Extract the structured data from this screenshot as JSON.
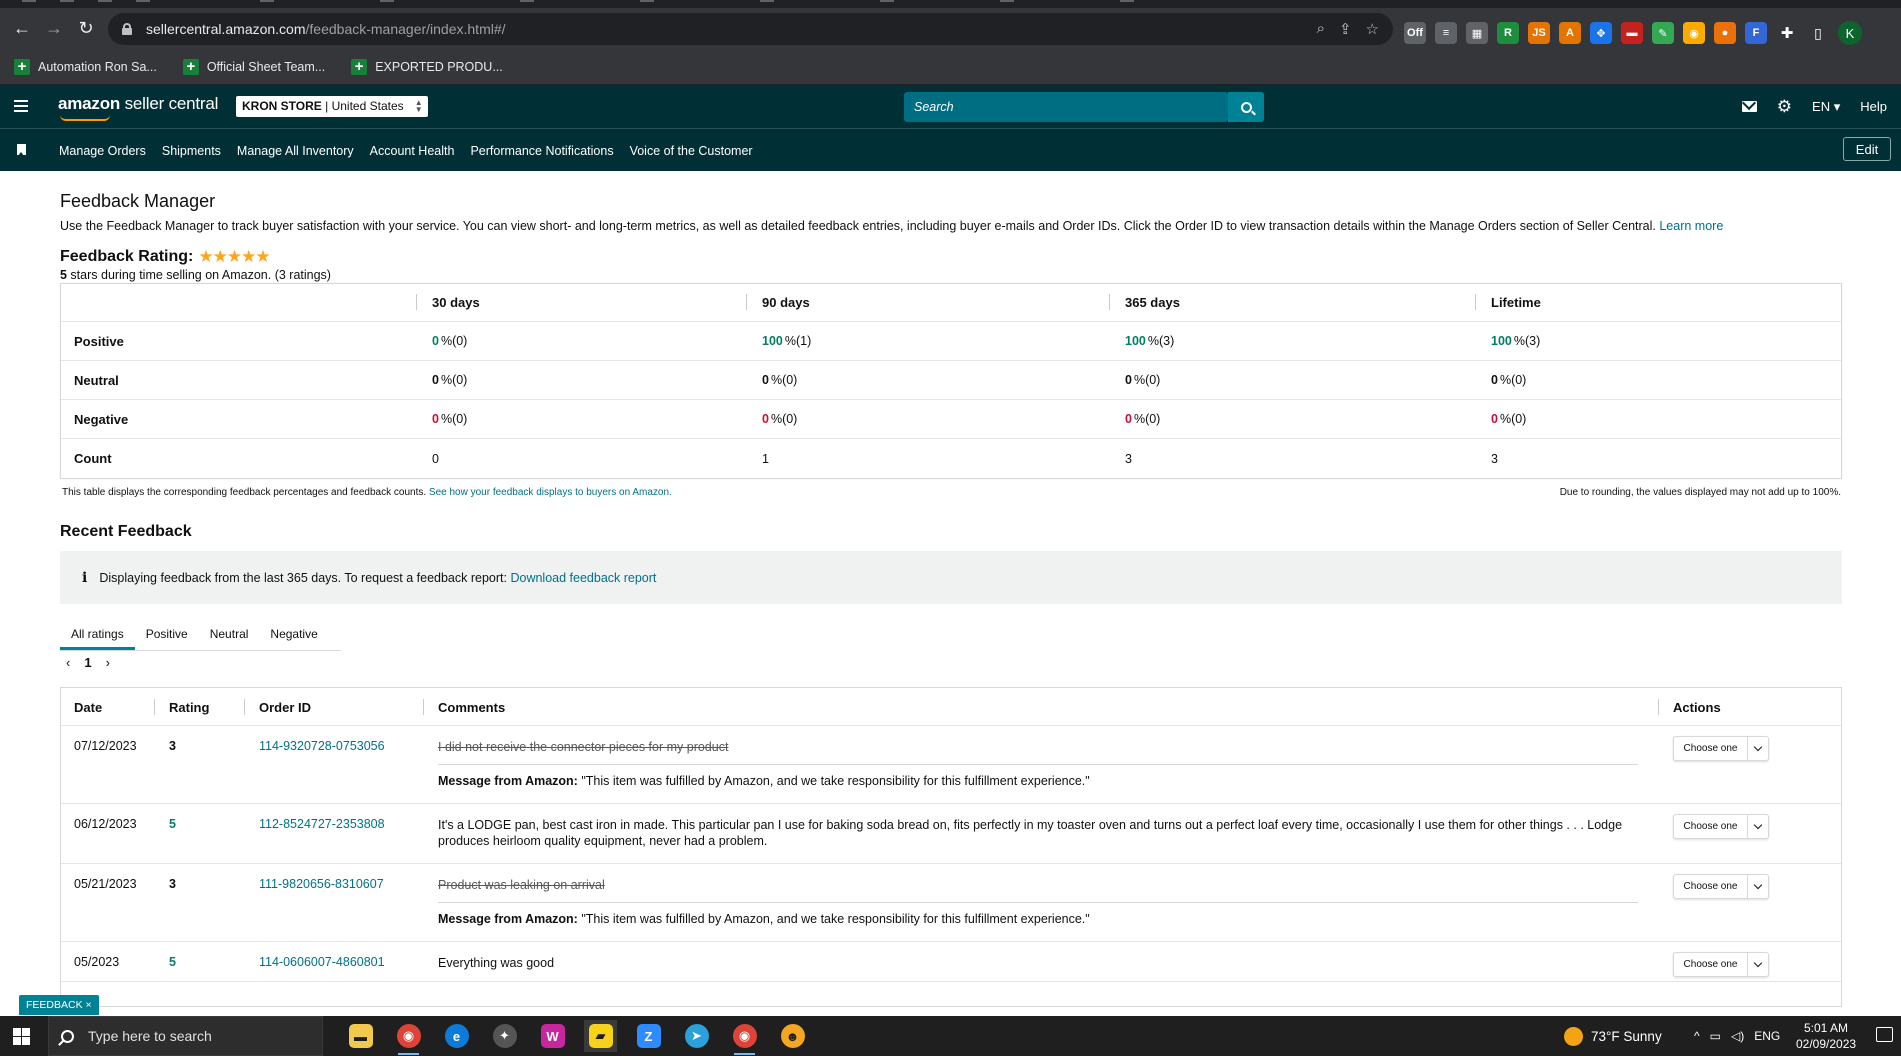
{
  "browser": {
    "url_host": "sellercentral.amazon.com",
    "url_path": "/feedback-manager/index.html#/",
    "bookmarks": [
      "Automation Ron Sa...",
      "Official Sheet Team...",
      "EXPORTED PRODU..."
    ],
    "profile_initial": "K",
    "extensions": [
      {
        "name": "off",
        "text": "Off",
        "color": "#5f6368"
      },
      {
        "name": "ext-a",
        "text": "≡",
        "color": "#5f6368"
      },
      {
        "name": "ext-b",
        "text": "▦",
        "color": "#5f6368"
      },
      {
        "name": "ext-r",
        "text": "R",
        "color": "#1e8e3e"
      },
      {
        "name": "ext-js",
        "text": "JS",
        "color": "#e37400"
      },
      {
        "name": "ext-az",
        "text": "A",
        "color": "#e37400"
      },
      {
        "name": "ext-move",
        "text": "✥",
        "color": "#1a73e8"
      },
      {
        "name": "ext-red",
        "text": "▬",
        "color": "#c5221f"
      },
      {
        "name": "ext-pen",
        "text": "✎",
        "color": "#34a853"
      },
      {
        "name": "ext-chrome",
        "text": "◉",
        "color": "#f9ab00"
      },
      {
        "name": "ext-o",
        "text": "●",
        "color": "#e8710a"
      },
      {
        "name": "ext-f",
        "text": "F",
        "color": "#3367d6"
      }
    ]
  },
  "header": {
    "logo_bold": "amazon",
    "logo_rest": " seller central",
    "store_name": "KRON STORE",
    "store_region": " | United States",
    "search_placeholder": "Search",
    "lang": "EN ▾",
    "help": "Help"
  },
  "nav": {
    "links": [
      "Manage Orders",
      "Shipments",
      "Manage All Inventory",
      "Account Health",
      "Performance Notifications",
      "Voice of the Customer"
    ],
    "edit": "Edit"
  },
  "page": {
    "title": "Feedback Manager",
    "description": "Use the Feedback Manager to track buyer satisfaction with your service. You can view short- and long-term metrics, as well as detailed feedback entries, including buyer e-mails and Order IDs. Click the Order ID to view transaction details within the Manage Orders section of Seller Central.",
    "learn_more": "Learn more",
    "rating_label": "Feedback Rating:",
    "stars": "★★★★★",
    "rating_summary_bold": "5",
    "rating_summary": " stars during time selling on Amazon. (3 ratings)"
  },
  "metrics": {
    "columns": [
      "30 days",
      "90 days",
      "365 days",
      "Lifetime"
    ],
    "rows": [
      {
        "label": "Positive",
        "kind": "positive",
        "values": [
          [
            "0",
            " %(0)"
          ],
          [
            "100",
            " %(1)"
          ],
          [
            "100",
            " %(3)"
          ],
          [
            "100",
            " %(3)"
          ]
        ]
      },
      {
        "label": "Neutral",
        "kind": "neutral",
        "values": [
          [
            "0",
            " %(0)"
          ],
          [
            "0",
            " %(0)"
          ],
          [
            "0",
            " %(0)"
          ],
          [
            "0",
            " %(0)"
          ]
        ]
      },
      {
        "label": "Negative",
        "kind": "negative",
        "values": [
          [
            "0",
            " %(0)"
          ],
          [
            "0",
            " %(0)"
          ],
          [
            "0",
            " %(0)"
          ],
          [
            "0",
            " %(0)"
          ]
        ]
      },
      {
        "label": "Count",
        "kind": "count",
        "values": [
          [
            "0",
            ""
          ],
          [
            "1",
            ""
          ],
          [
            "3",
            ""
          ],
          [
            "3",
            ""
          ]
        ]
      }
    ],
    "note": "This table displays the corresponding feedback percentages and feedback counts.",
    "note_link": "See how your feedback displays to buyers on Amazon.",
    "rounding_note": "Due to rounding, the values displayed may not add up to 100%."
  },
  "recent": {
    "title": "Recent Feedback",
    "banner_text": "Displaying feedback from the last 365 days. To request a feedback report:",
    "banner_link": "Download feedback report",
    "tabs": [
      "All ratings",
      "Positive",
      "Neutral",
      "Negative"
    ],
    "page": "1",
    "columns": [
      "Date",
      "Rating",
      "Order ID",
      "Comments",
      "Actions"
    ],
    "amazon_msg_label": "Message from Amazon:",
    "amazon_msg_text": " \"This item was fulfilled by Amazon, and we take responsibility for this fulfillment experience.\"",
    "action_label": "Choose one",
    "rows": [
      {
        "date": "07/12/2023",
        "rating": "3",
        "order_id": "114-9320728-0753056",
        "comment": "I did not receive the connector pieces for my product",
        "struck": true
      },
      {
        "date": "06/12/2023",
        "rating": "5",
        "order_id": "112-8524727-2353808",
        "comment": "It's a LODGE pan, best cast iron in made. This particular pan I use for baking soda bread on, fits perfectly in my toaster oven and turns out a perfect loaf every time, occasionally I use them for other things . . . Lodge produces heirloom quality equipment, never had a problem.",
        "struck": false
      },
      {
        "date": "05/21/2023",
        "rating": "3",
        "order_id": "111-9820656-8310607",
        "comment": "Product was leaking on arrival",
        "struck": true
      },
      {
        "date": "05/2023",
        "rating": "5",
        "order_id": "114-0606007-4860801",
        "comment": "Everything was good",
        "struck": false
      }
    ]
  },
  "feedback_tab": "FEEDBACK ×",
  "taskbar": {
    "search_placeholder": "Type here to search",
    "weather": "73°F  Sunny",
    "lang": "ENG",
    "time": "5:01 AM",
    "date": "02/09/2023"
  }
}
